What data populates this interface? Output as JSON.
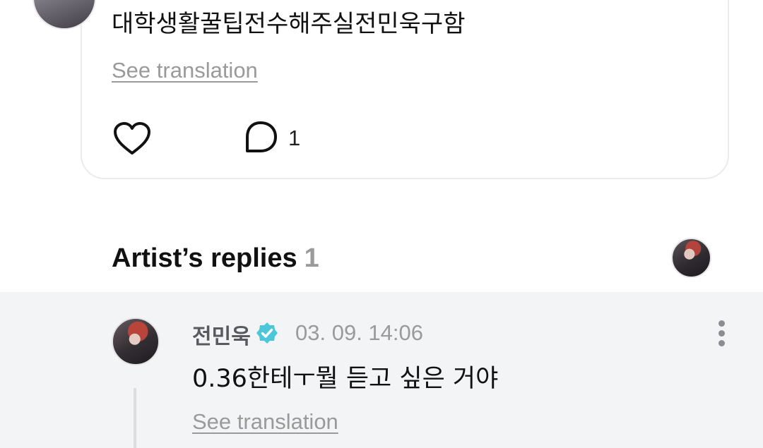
{
  "post": {
    "text": "대학생활꿀팁전수해주실전민욱구함",
    "see_translation": "See translation",
    "like_icon": "heart-outline-icon",
    "comment_icon": "comment-bubble-icon",
    "comment_count": "1"
  },
  "section": {
    "title": "Artist’s replies",
    "count": "1"
  },
  "reply": {
    "author": "전민욱",
    "verified_icon": "verified-badge-icon",
    "verified_color": "#4cc6d9",
    "timestamp": "03. 09. 14:06",
    "text": "0.36한테ㅜ뭘 듣고 싶은 거야",
    "see_translation": "See translation",
    "more_icon": "more-vertical-icon"
  },
  "colors": {
    "background": "#ffffff",
    "reply_background": "#f3f4f5",
    "muted_text": "#9a9a9a",
    "primary_text": "#111111"
  }
}
